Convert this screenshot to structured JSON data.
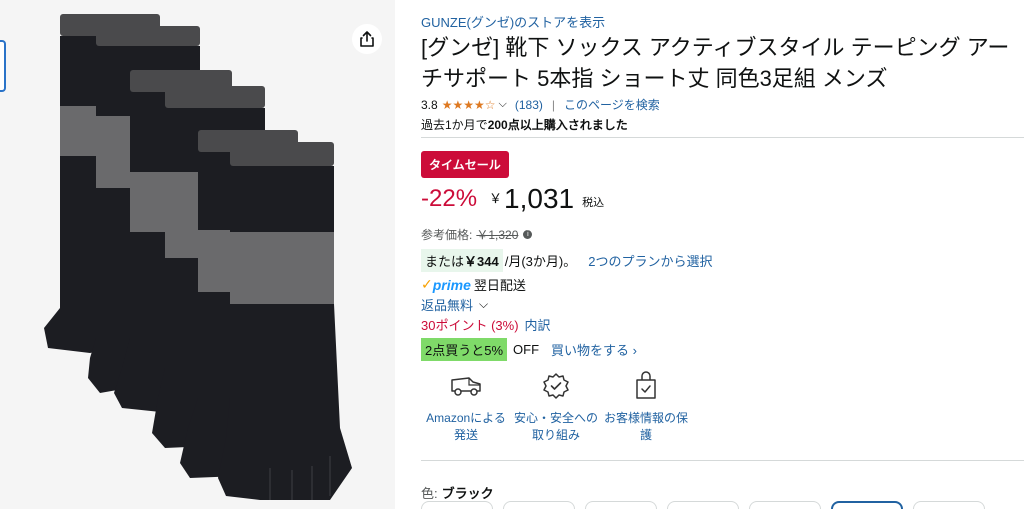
{
  "image": {
    "alt_icon": "socks-product-image"
  },
  "store_link": "GUNZE(グンゼ)のストアを表示",
  "title": "[グンゼ] 靴下 ソックス アクティブスタイル テーピング アーチサポート 5本指 ショート丈 同色3足組 メンズ",
  "rating": {
    "value": "3.8",
    "stars": 3.8,
    "count": "(183)",
    "search_link": "このページを検索"
  },
  "bought_prefix": "過去1か月で",
  "bought_bold": "200点以上購入されました",
  "deal_badge": "タイムセール",
  "price": {
    "discount": "-22%",
    "currency": "￥",
    "amount": "1,031",
    "tax": "税込"
  },
  "reference": {
    "label": "参考価格:",
    "price": "￥1,320"
  },
  "installment": {
    "prefix": "または",
    "amount": "￥344",
    "suffix": "/月(3か月)。",
    "link": "2つのプランから選択"
  },
  "prime": {
    "check": "✓",
    "word": "prime",
    "delivery": "翌日配送"
  },
  "returns": "返品無料",
  "points": {
    "value": "30ポイント (3%)",
    "link": "内訳"
  },
  "promo": {
    "pill": "2点買うと5%",
    "off": "OFF",
    "link": "買い物をする ›"
  },
  "features": [
    {
      "icon": "delivery-truck-icon",
      "label": "Amazonによる発送"
    },
    {
      "icon": "badge-check-icon",
      "label": "安心・安全への取り組み"
    },
    {
      "icon": "secure-bag-icon",
      "label": "お客様情報の保護"
    }
  ],
  "color": {
    "label": "色:",
    "value": "ブラック"
  },
  "colors": {
    "deal_red": "#cc0c39",
    "link_blue": "#2162a1",
    "star_orange": "#de7921",
    "promo_green": "#7fda69"
  }
}
